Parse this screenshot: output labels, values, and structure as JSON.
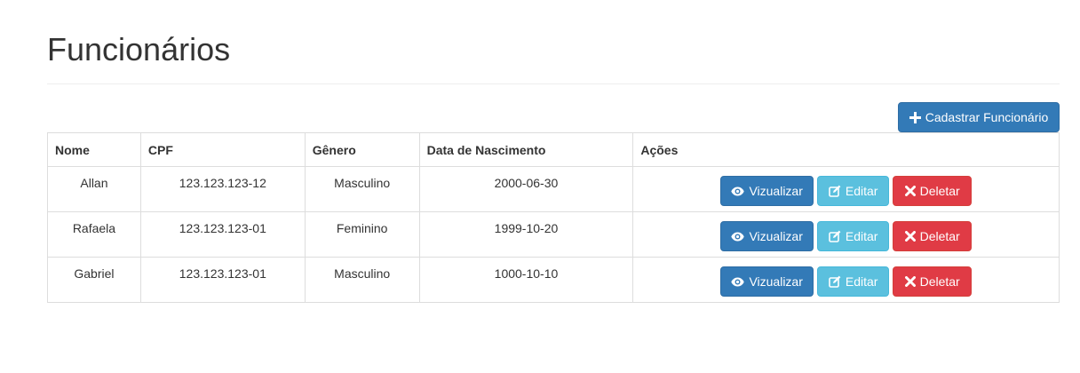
{
  "page": {
    "title": "Funcionários"
  },
  "toolbar": {
    "add_label": "Cadastrar Funcionário",
    "add_icon": "plus-icon"
  },
  "table": {
    "headers": [
      "Nome",
      "CPF",
      "Gênero",
      "Data de Nascimento",
      "Ações"
    ],
    "rows": [
      {
        "nome": "Allan",
        "cpf": "123.123.123-12",
        "genero": "Masculino",
        "nascimento": "2000-06-30"
      },
      {
        "nome": "Rafaela",
        "cpf": "123.123.123-01",
        "genero": "Feminino",
        "nascimento": "1999-10-20"
      },
      {
        "nome": "Gabriel",
        "cpf": "123.123.123-01",
        "genero": "Masculino",
        "nascimento": "1000-10-10"
      }
    ]
  },
  "actions": {
    "view_label": "Vizualizar",
    "view_icon": "eye-icon",
    "edit_label": "Editar",
    "edit_icon": "edit-icon",
    "delete_label": "Deletar",
    "delete_icon": "close-icon"
  },
  "colors": {
    "primary": "#337ab7",
    "info": "#5bc0de",
    "danger": "#e03b45"
  }
}
